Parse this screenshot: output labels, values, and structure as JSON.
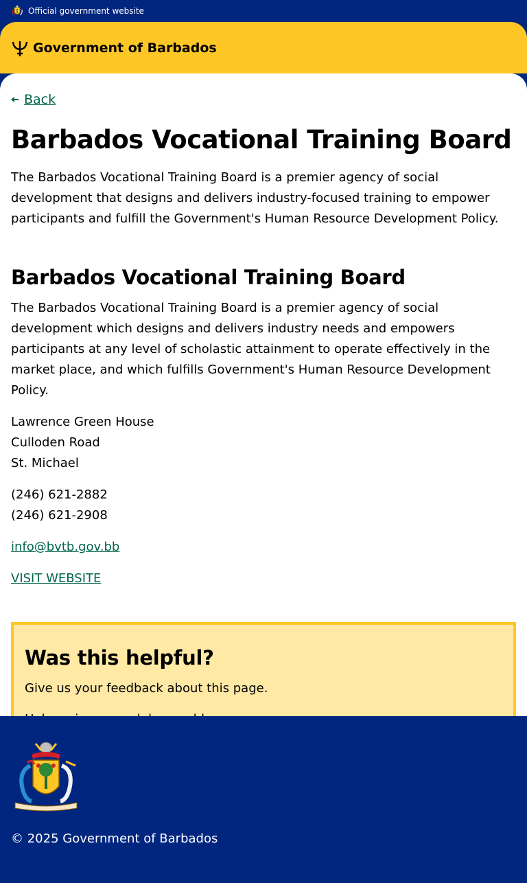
{
  "topbar": {
    "label": "Official government website",
    "icon": "coat-of-arms-icon"
  },
  "header": {
    "brand": "Government of Barbados",
    "icon": "trident-icon"
  },
  "back": {
    "label": "Back",
    "icon": "arrow-left-icon"
  },
  "page": {
    "title": "Barbados Vocational Training Board",
    "lead": "The Barbados Vocational Training Board is a premier agency of social development that designs and delivers industry-focused training to empower participants and fulfill the Government's Human Resource Development Policy.",
    "section_title": "Barbados Vocational Training Board",
    "section_desc": "The Barbados Vocational Training Board is a premier agency of social development which designs and delivers industry needs and empowers participants at any level of scholastic attainment to operate effectively in the market place, and which fulfills Government's Human Resource Development Policy.",
    "address": [
      "Lawrence Green House",
      "Culloden Road",
      "St. Michael"
    ],
    "phones": [
      "(246) 621-2882",
      "(246) 621-2908"
    ],
    "email": "info@bvtb.gov.bb",
    "website_label": "VISIT WEBSITE"
  },
  "feedback": {
    "title": "Was this helpful?",
    "text": "Give us your feedback about this page.",
    "link": "Help us improve alpha.gov.bb"
  },
  "footer": {
    "copyright": "© 2025 Government of Barbados",
    "emblem_motto": "PRIDE AND INDUSTRY"
  },
  "colors": {
    "navy": "#00267f",
    "gold": "#ffc726",
    "pale_gold": "#ffe9a5",
    "link_green": "#00654a"
  }
}
